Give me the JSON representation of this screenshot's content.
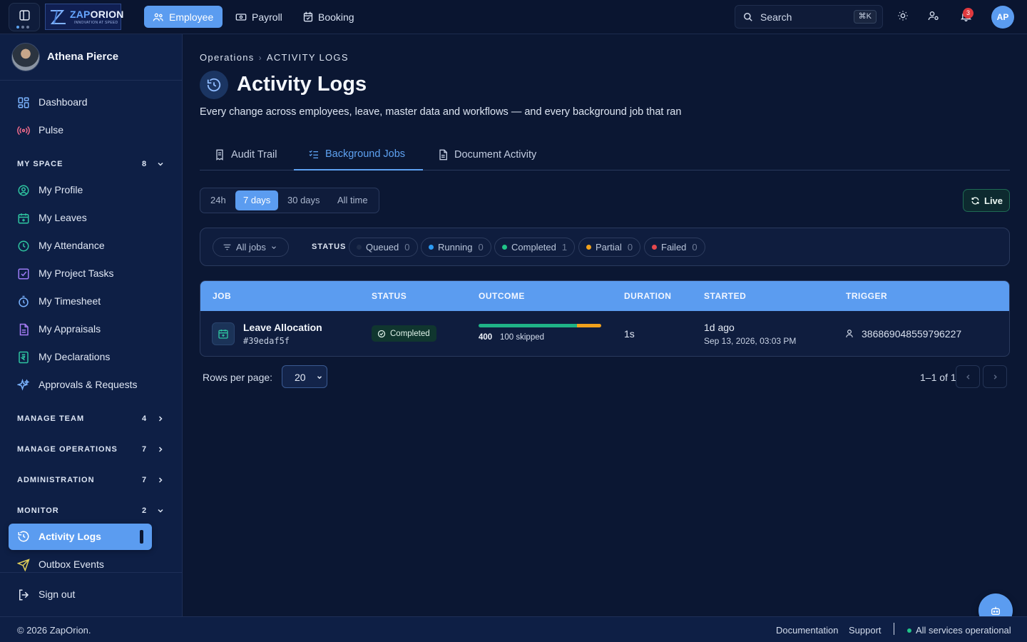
{
  "brand": {
    "name_a": "ZAP",
    "name_b": "ORION",
    "tagline": "INNOVATION AT SPEED"
  },
  "topnav": [
    {
      "label": "Employee",
      "icon": "users-icon",
      "active": true
    },
    {
      "label": "Payroll",
      "icon": "cash-icon",
      "active": false
    },
    {
      "label": "Booking",
      "icon": "calendar-icon",
      "active": false
    }
  ],
  "search": {
    "placeholder": "Search",
    "shortcut": "⌘K"
  },
  "notifications": {
    "count": "3"
  },
  "user": {
    "initials": "AP",
    "name": "Athena Pierce"
  },
  "sidebar": {
    "top_items": [
      {
        "label": "Dashboard",
        "icon": "dashboard-icon"
      },
      {
        "label": "Pulse",
        "icon": "broadcast-icon"
      }
    ],
    "my_space": {
      "title": "MY SPACE",
      "count": "8",
      "items": [
        {
          "label": "My Profile",
          "icon": "user-circle-icon"
        },
        {
          "label": "My Leaves",
          "icon": "calendar-plus-icon"
        },
        {
          "label": "My Attendance",
          "icon": "clock-icon"
        },
        {
          "label": "My Project Tasks",
          "icon": "checkbox-icon"
        },
        {
          "label": "My Timesheet",
          "icon": "stopwatch-icon"
        },
        {
          "label": "My Appraisals",
          "icon": "document-icon"
        },
        {
          "label": "My Declarations",
          "icon": "rupee-doc-icon"
        },
        {
          "label": "Approvals & Requests",
          "icon": "sparkle-icon"
        }
      ]
    },
    "manage_team": {
      "title": "MANAGE TEAM",
      "count": "4"
    },
    "manage_operations": {
      "title": "MANAGE OPERATIONS",
      "count": "7"
    },
    "administration": {
      "title": "ADMINISTRATION",
      "count": "7"
    },
    "monitor": {
      "title": "MONITOR",
      "count": "2",
      "items": [
        {
          "label": "Activity Logs",
          "icon": "history-icon",
          "active": true
        },
        {
          "label": "Outbox Events",
          "icon": "send-icon"
        }
      ]
    },
    "sign_out": "Sign out"
  },
  "breadcrumb": {
    "parent": "Operations",
    "current": "ACTIVITY LOGS"
  },
  "page": {
    "title": "Activity Logs",
    "subtitle": "Every change across employees, leave, master data and workflows — and every background job that ran"
  },
  "tabs": [
    {
      "label": "Audit Trail",
      "icon": "receipt-icon",
      "active": false
    },
    {
      "label": "Background Jobs",
      "icon": "list-check-icon",
      "active": true
    },
    {
      "label": "Document Activity",
      "icon": "file-icon",
      "active": false
    }
  ],
  "time_range": {
    "options": [
      "24h",
      "7 days",
      "30 days",
      "All time"
    ],
    "selected": "7 days"
  },
  "live_label": "Live",
  "filters": {
    "all_jobs": "All jobs",
    "status_label": "STATUS",
    "chips": [
      {
        "label": "Queued",
        "count": "0",
        "color": "#1e2c4a"
      },
      {
        "label": "Running",
        "count": "0",
        "color": "#2b9af3"
      },
      {
        "label": "Completed",
        "count": "1",
        "color": "#20c488"
      },
      {
        "label": "Partial",
        "count": "0",
        "color": "#f0a11c"
      },
      {
        "label": "Failed",
        "count": "0",
        "color": "#e5484d"
      }
    ]
  },
  "table": {
    "columns": [
      "JOB",
      "STATUS",
      "OUTCOME",
      "DURATION",
      "STARTED",
      "TRIGGER"
    ],
    "rows": [
      {
        "job": "Leave Allocation",
        "id": "#39edaf5f",
        "status": "Completed",
        "outcome_processed": "400",
        "outcome_skipped_label": "100 skipped",
        "outcome_done_fraction": 0.8,
        "outcome_skipped_fraction": 0.2,
        "duration": "1s",
        "started_relative": "1d ago",
        "started_absolute": "Sep 13, 2026, 03:03 PM",
        "trigger": "386869048559796227"
      }
    ]
  },
  "pagination": {
    "rows_label": "Rows per page:",
    "rows_value": "20",
    "info": "1–1 of 1"
  },
  "footer": {
    "copyright": "© 2026 ZapOrion.",
    "documentation": "Documentation",
    "support": "Support",
    "status": "All services operational"
  },
  "colors": {
    "accent": "#5b9cf0",
    "success": "#20c488",
    "warning": "#f0a11c",
    "danger": "#e5484d",
    "background": "#0b1733"
  }
}
